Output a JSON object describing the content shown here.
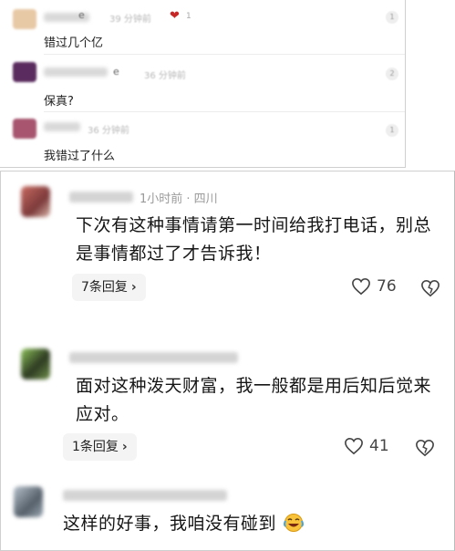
{
  "top_comments": [
    {
      "name_tail": "e",
      "time": "39 分钟前",
      "like_count": "1",
      "badge": "1",
      "text": "错过几个亿",
      "avatar_color": "#e8c9a6"
    },
    {
      "name_tail": "e",
      "time": "36 分钟前",
      "badge": "2",
      "text": "保真?",
      "avatar_color": "#5a2b5e"
    },
    {
      "time": "36 分钟前",
      "badge": "1",
      "text": "我错过了什么",
      "avatar_color": "#a85670"
    }
  ],
  "comments": [
    {
      "meta": "1小时前 · 四川",
      "text": "下次有这种事情请第一时间给我打电话，别总是事情都过了才告诉我！",
      "replies_label": "7条回复",
      "likes": "76",
      "avatar_color": "#9c4a44"
    },
    {
      "meta": "",
      "text": "面对这种泼天财富，我一般都是用后知后觉来应对。",
      "replies_label": "1条回复",
      "likes": "41",
      "avatar_color": "#6b9a3e"
    },
    {
      "meta": "",
      "text": "这样的好事，我咱没有碰到",
      "avatar_color": "#7f8d99"
    }
  ],
  "icons": {
    "like": "heart-outline-icon",
    "dislike": "broken-heart-icon",
    "reaction": "crying-laughing-emoji-icon"
  }
}
